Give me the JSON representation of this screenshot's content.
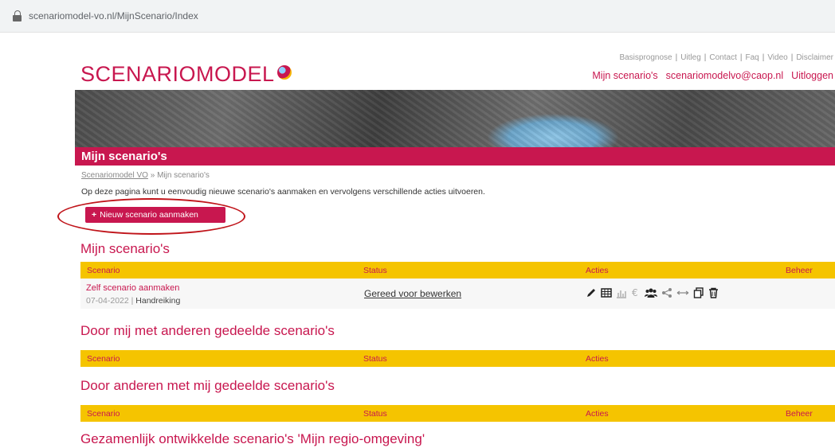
{
  "browser": {
    "url": "scenariomodel-vo.nl/MijnScenario/Index"
  },
  "header": {
    "logo_text": "SCENARIOMODEL",
    "top_links": [
      "Basisprognose",
      "Uitleg",
      "Contact",
      "Faq",
      "Video",
      "Disclaimer"
    ],
    "user_links": {
      "my_scenarios": "Mijn scenario's",
      "email": "scenariomodelvo@caop.nl",
      "logout": "Uitloggen"
    }
  },
  "page": {
    "title": "Mijn scenario's",
    "breadcrumb": {
      "home": "Scenariomodel VO",
      "separator": "»",
      "current": "Mijn scenario's"
    },
    "intro": "Op deze pagina kunt u eenvoudig nieuwe scenario's aanmaken en vervolgens verschillende acties uitvoeren.",
    "new_button": "Nieuw scenario aanmaken"
  },
  "sections": [
    {
      "title": "Mijn scenario's",
      "columns": [
        "Scenario",
        "Status",
        "Acties",
        "Beheer"
      ],
      "rows": [
        {
          "name": "Zelf scenario aanmaken",
          "date": "07-04-2022",
          "type": "Handreiking",
          "status": "Gereed voor bewerken"
        }
      ]
    },
    {
      "title": "Door mij met anderen gedeelde scenario's",
      "columns": [
        "Scenario",
        "Status",
        "Acties",
        ""
      ]
    },
    {
      "title": "Door anderen met mij gedeelde scenario's",
      "columns": [
        "Scenario",
        "Status",
        "Acties",
        "Beheer"
      ]
    },
    {
      "title": "Gezamenlijk ontwikkelde scenario's 'Mijn regio-omgeving'"
    }
  ],
  "action_icons": [
    "pencil-icon",
    "table-icon",
    "bar-chart-icon",
    "euro-icon",
    "group-icon",
    "share-icon",
    "arrows-icon",
    "copy-icon",
    "trash-icon"
  ],
  "colors": {
    "brand": "#c8174f",
    "header_row": "#f5c400",
    "annotation": "#c0141a"
  }
}
